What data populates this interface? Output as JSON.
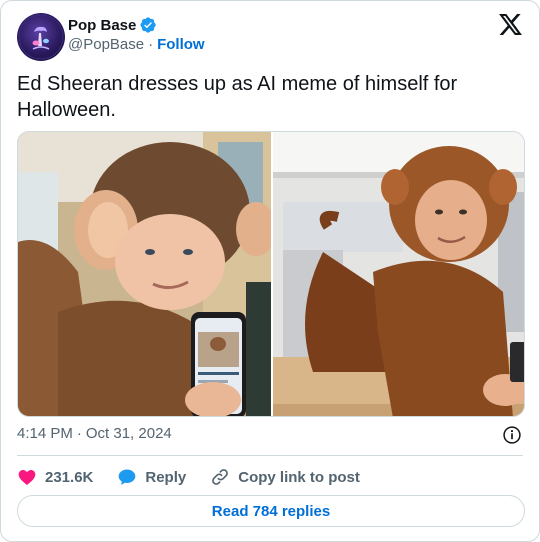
{
  "author": {
    "display_name": "Pop Base",
    "handle": "@PopBase",
    "separator": "·",
    "follow_label": "Follow",
    "verified": true
  },
  "tweet": {
    "text": "Ed Sheeran dresses up as AI meme of himself for Halloween.",
    "time": "4:14 PM",
    "date_separator": "·",
    "date": "Oct 31, 2024"
  },
  "media": {
    "photos": [
      {
        "icon": "person-in-monkey-costume-holding-phone"
      },
      {
        "icon": "person-in-monkey-costume-on-table"
      }
    ]
  },
  "actions": {
    "like_count": "231.6K",
    "reply_label": "Reply",
    "copy_link_label": "Copy link to post"
  },
  "read_replies_label": "Read 784 replies",
  "colors": {
    "accent": "#006fd6",
    "like": "#f91880",
    "reply": "#1d9bf0",
    "verified": "#1d9bf0",
    "secondary_text": "#536471",
    "border": "#cfd9de"
  }
}
